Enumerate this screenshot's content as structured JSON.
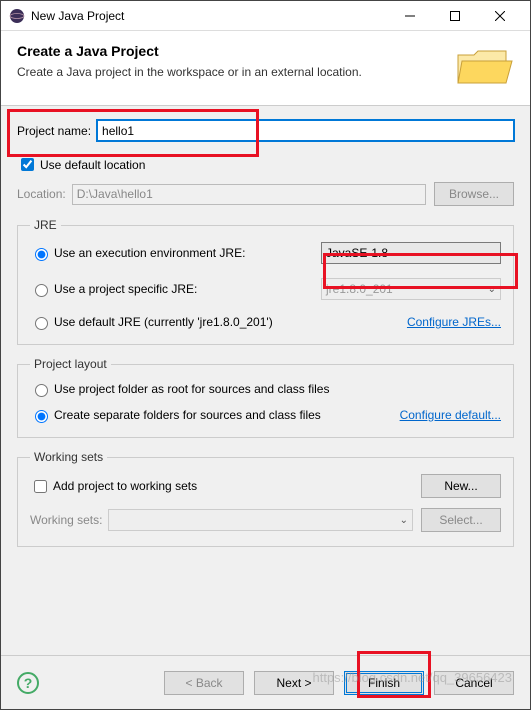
{
  "window": {
    "title": "New Java Project"
  },
  "header": {
    "title": "Create a Java Project",
    "subtitle": "Create a Java project in the workspace or in an external location."
  },
  "project": {
    "name_label": "Project name:",
    "name_value": "hello1",
    "use_default_location_label": "Use default location",
    "use_default_location_checked": true,
    "location_label": "Location:",
    "location_value": "D:\\Java\\hello1",
    "browse_label": "Browse..."
  },
  "jre": {
    "legend": "JRE",
    "exec_env_label": "Use an execution environment JRE:",
    "exec_env_value": "JavaSE-1.8",
    "project_specific_label": "Use a project specific JRE:",
    "project_specific_value": "jre1.8.0_201",
    "default_jre_label": "Use default JRE (currently 'jre1.8.0_201')",
    "configure_link": "Configure JREs...",
    "selected": "exec_env"
  },
  "layout": {
    "legend": "Project layout",
    "root_label": "Use project folder as root for sources and class files",
    "separate_label": "Create separate folders for sources and class files",
    "configure_link": "Configure default...",
    "selected": "separate"
  },
  "working_sets": {
    "legend": "Working sets",
    "add_label": "Add project to working sets",
    "add_checked": false,
    "new_label": "New...",
    "field_label": "Working sets:",
    "select_label": "Select..."
  },
  "buttons": {
    "back": "< Back",
    "next": "Next >",
    "finish": "Finish",
    "cancel": "Cancel"
  },
  "watermark": "https://blog.csdn.net/qq_39656423"
}
